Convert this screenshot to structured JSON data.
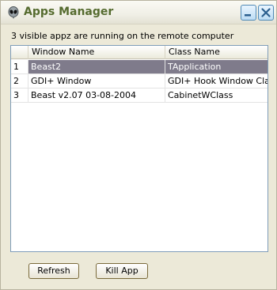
{
  "window": {
    "title": "Apps Manager",
    "minimize_icon": "minimize-icon",
    "close_icon": "close-icon",
    "app_icon": "alien-head-icon"
  },
  "status_text": "3 visible appz are running on the remote computer",
  "list": {
    "columns": [
      "",
      "Window Name",
      "Class Name"
    ],
    "rows": [
      {
        "num": "1",
        "window_name": "Beast2",
        "class_name": "TApplication",
        "selected": true
      },
      {
        "num": "2",
        "window_name": "GDI+ Window",
        "class_name": "GDI+ Hook Window Class",
        "selected": false
      },
      {
        "num": "3",
        "window_name": "Beast v2.07 03-08-2004",
        "class_name": "CabinetWClass",
        "selected": false
      }
    ]
  },
  "buttons": {
    "refresh": "Refresh",
    "kill_app": "Kill App"
  },
  "colors": {
    "title_text": "#556b2f",
    "selection": "#7f7b8b"
  }
}
